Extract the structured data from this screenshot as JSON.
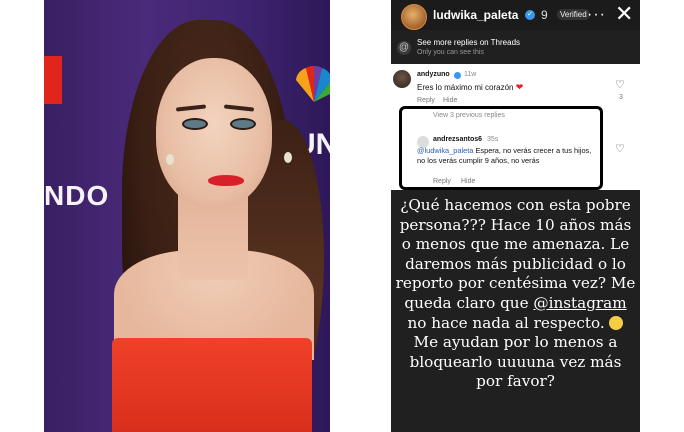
{
  "photo": {
    "logo_text": "NDO",
    "logo_text2": "UN"
  },
  "header": {
    "username": "ludwika_paleta",
    "time": "9",
    "verified_chip": "Verified",
    "more_icon": "more-icon",
    "close_icon": "close-icon"
  },
  "threads": {
    "text": "See more replies on Threads",
    "sub": "Only you can see this"
  },
  "comment": {
    "username": "andyzuno",
    "time": "11w",
    "text": "Eres lo máximo mi corazón",
    "reply": "Reply",
    "hide": "Hide",
    "likes": "3"
  },
  "view_previous": "View 3 previous replies",
  "reply": {
    "username": "andrezsantos6",
    "time": "35s",
    "mention": "@ludwika_paleta",
    "text": " Espera, no verás crecer a tus hijos, no los verás cumplir 9 años, no verás",
    "reply": "Reply",
    "hide": "Hide"
  },
  "story": {
    "line_a": "¿Qué hacemos con esta pobre persona??? Hace 10 años más o menos que me amenaza. Le daremos más publicidad o lo reporto por centésima vez? Me queda claro que ",
    "mention": "@instagram",
    "line_b": " no hace nada al respecto.",
    "line_c": "Me ayudan por lo menos a bloquearlo uuuuna vez más por favor?"
  },
  "colors": {
    "accent": "#3897f0",
    "mention": "#2a5eb8",
    "heart": "#e0262d",
    "dress": "#e63623"
  }
}
